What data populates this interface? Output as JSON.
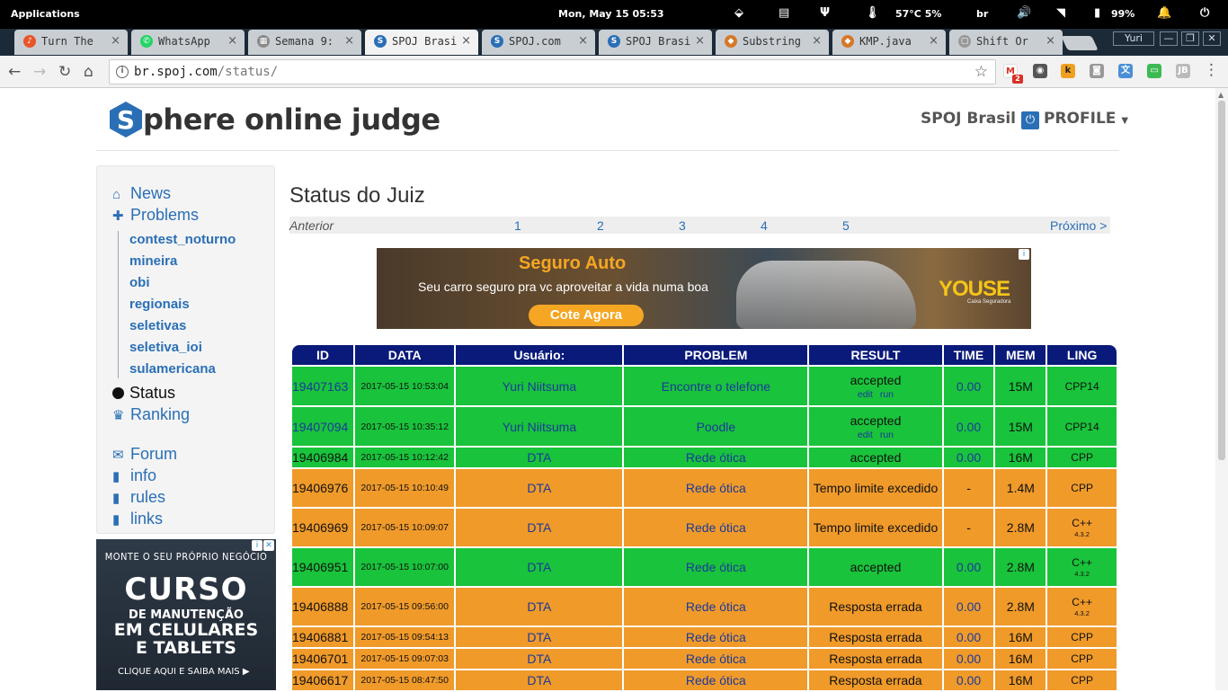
{
  "os": {
    "applications_label": "Applications",
    "datetime": "Mon, May 15  05:53",
    "temperature": "57°C 5%",
    "keyboard_layout": "br",
    "battery": "99%"
  },
  "tabs": [
    {
      "title": "Turn The",
      "color": "#e8552a",
      "glyph": "♪"
    },
    {
      "title": "WhatsApp",
      "color": "#25d366",
      "glyph": "✆"
    },
    {
      "title": "Semana 9:",
      "color": "#8a8a8a",
      "glyph": "▦"
    },
    {
      "title": "SPOJ Brasi",
      "color": "#2a6fb5",
      "glyph": "S",
      "active": true
    },
    {
      "title": "SPOJ.com",
      "color": "#2a6fb5",
      "glyph": "S"
    },
    {
      "title": "SPOJ Brasi",
      "color": "#2a6fb5",
      "glyph": "S"
    },
    {
      "title": "Substring",
      "color": "#d4782a",
      "glyph": "◆"
    },
    {
      "title": "KMP.java",
      "color": "#d4782a",
      "glyph": "◆"
    },
    {
      "title": "Shift Or",
      "color": "#999999",
      "glyph": "▢"
    }
  ],
  "window": {
    "user": "Yuri"
  },
  "address": {
    "host": "br.spoj.com",
    "path": "/status/"
  },
  "extensions": {
    "gmail_badge": "2"
  },
  "header": {
    "logo_letter": "S",
    "logo_text": "phere online judge",
    "community": "SPOJ Brasil",
    "profile": "PROFILE"
  },
  "sidebar": {
    "news": "News",
    "problems": "Problems",
    "subs": [
      "contest_noturno",
      "mineira",
      "obi",
      "regionais",
      "seletivas",
      "seletiva_ioi",
      "sulamericana"
    ],
    "status": "Status",
    "ranking": "Ranking",
    "forum": "Forum",
    "info": "info",
    "rules": "rules",
    "links": "links"
  },
  "side_ad": {
    "line1": "MONTE O SEU PRÓPRIO NEGÓCIO",
    "line2": "CURSO",
    "line3": "DE MANUTENÇÃO",
    "line4": "EM CELULARES",
    "line5": "E TABLETS",
    "line6": "CLIQUE AQUI E SAIBA MAIS ▶"
  },
  "main": {
    "title": "Status do Juiz",
    "pager": {
      "prev": "Anterior",
      "pages": [
        "1",
        "2",
        "3",
        "4",
        "5"
      ],
      "next": "Próximo >"
    }
  },
  "top_ad": {
    "title": "Seguro Auto",
    "subtitle": "Seu carro seguro pra vc aproveitar a vida numa boa",
    "cta": "Cote Agora",
    "brand": "YOUSE",
    "brand_sub": "Caixa Seguradora"
  },
  "table": {
    "headers": [
      "ID",
      "DATA",
      "Usuário:",
      "PROBLEM",
      "RESULT",
      "TIME",
      "MEM",
      "LING"
    ],
    "result_links": [
      "edit",
      "run"
    ],
    "rows": [
      {
        "id": "19407163",
        "date": "2017-05-15 10:53:04",
        "user": "Yuri Niitsuma",
        "problem": "Encontre o telefone",
        "result": "accepted",
        "links": true,
        "time": "0.00",
        "mem": "15M",
        "lang": "CPP14",
        "lang_sub": "",
        "ok": true,
        "id_link": true
      },
      {
        "id": "19407094",
        "date": "2017-05-15 10:35:12",
        "user": "Yuri Niitsuma",
        "problem": "Poodle",
        "result": "accepted",
        "links": true,
        "time": "0.00",
        "mem": "15M",
        "lang": "CPP14",
        "lang_sub": "",
        "ok": true,
        "id_link": true
      },
      {
        "id": "19406984",
        "date": "2017-05-15 10:12:42",
        "user": "DTA",
        "problem": "Rede ótica",
        "result": "accepted",
        "links": false,
        "time": "0.00",
        "mem": "16M",
        "lang": "CPP",
        "lang_sub": "",
        "ok": true,
        "id_link": false
      },
      {
        "id": "19406976",
        "date": "2017-05-15 10:10:49",
        "user": "DTA",
        "problem": "Rede ótica",
        "result": "Tempo limite excedido",
        "links": false,
        "time": "-",
        "mem": "1.4M",
        "lang": "CPP",
        "lang_sub": "",
        "ok": false,
        "id_link": false
      },
      {
        "id": "19406969",
        "date": "2017-05-15 10:09:07",
        "user": "DTA",
        "problem": "Rede ótica",
        "result": "Tempo limite excedido",
        "links": false,
        "time": "-",
        "mem": "2.8M",
        "lang": "C++",
        "lang_sub": "4.3.2",
        "ok": false,
        "id_link": false
      },
      {
        "id": "19406951",
        "date": "2017-05-15 10:07:00",
        "user": "DTA",
        "problem": "Rede ótica",
        "result": "accepted",
        "links": false,
        "time": "0.00",
        "mem": "2.8M",
        "lang": "C++",
        "lang_sub": "4.3.2",
        "ok": true,
        "id_link": false
      },
      {
        "id": "19406888",
        "date": "2017-05-15 09:56:00",
        "user": "DTA",
        "problem": "Rede ótica",
        "result": "Resposta errada",
        "links": false,
        "time": "0.00",
        "mem": "2.8M",
        "lang": "C++",
        "lang_sub": "4.3.2",
        "ok": false,
        "id_link": false
      },
      {
        "id": "19406881",
        "date": "2017-05-15 09:54:13",
        "user": "DTA",
        "problem": "Rede ótica",
        "result": "Resposta errada",
        "links": false,
        "time": "0.00",
        "mem": "16M",
        "lang": "CPP",
        "lang_sub": "",
        "ok": false,
        "id_link": false
      },
      {
        "id": "19406701",
        "date": "2017-05-15 09:07:03",
        "user": "DTA",
        "problem": "Rede ótica",
        "result": "Resposta errada",
        "links": false,
        "time": "0.00",
        "mem": "16M",
        "lang": "CPP",
        "lang_sub": "",
        "ok": false,
        "id_link": false
      },
      {
        "id": "19406617",
        "date": "2017-05-15 08:47:50",
        "user": "DTA",
        "problem": "Rede ótica",
        "result": "Resposta errada",
        "links": false,
        "time": "0.00",
        "mem": "16M",
        "lang": "CPP",
        "lang_sub": "",
        "ok": false,
        "id_link": false
      }
    ]
  },
  "colors": {
    "accepted": "#19c33b",
    "rejected": "#f09a2a",
    "header": "#0a1a7a",
    "link": "#2a6fb5"
  }
}
